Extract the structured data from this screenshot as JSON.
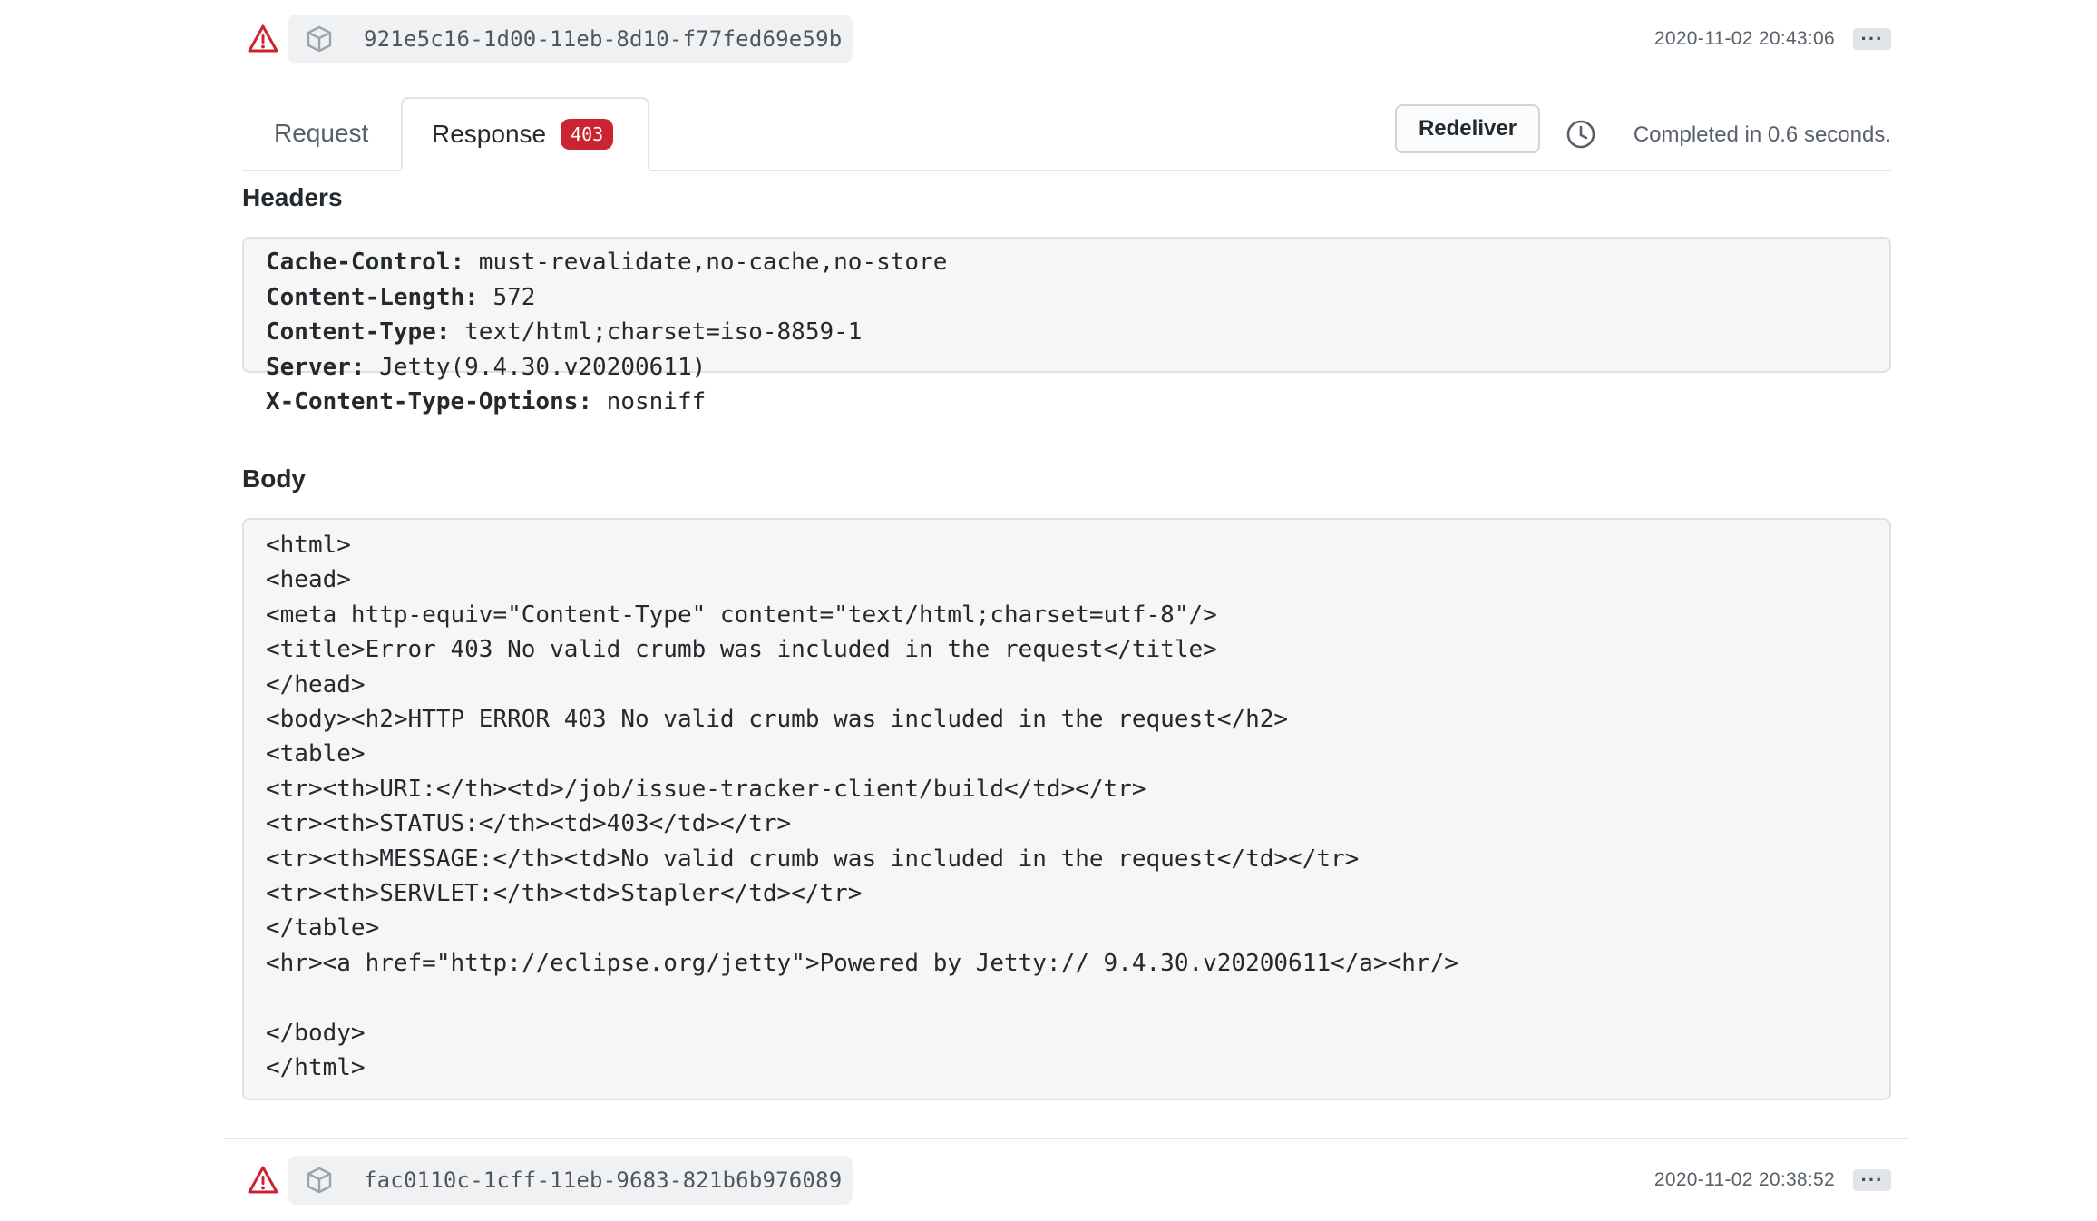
{
  "deliveries": [
    {
      "guid": "921e5c16-1d00-11eb-8d10-f77fed69e59b",
      "timestamp": "2020-11-02 20:43:06",
      "status_icon": "alert-icon",
      "more_label": "···"
    },
    {
      "guid": "fac0110c-1cff-11eb-9683-821b6b976089",
      "timestamp": "2020-11-02 20:38:52",
      "status_icon": "alert-icon",
      "more_label": "···"
    }
  ],
  "tabs": {
    "request": "Request",
    "response": "Response",
    "response_badge": "403"
  },
  "actions": {
    "redeliver": "Redeliver",
    "completed": "Completed in 0.6 seconds."
  },
  "headers_section": {
    "title": "Headers",
    "items": [
      {
        "key": "Cache-Control:",
        "value": " must-revalidate,no-cache,no-store"
      },
      {
        "key": "Content-Length:",
        "value": " 572"
      },
      {
        "key": "Content-Type:",
        "value": " text/html;charset=iso-8859-1"
      },
      {
        "key": "Server:",
        "value": " Jetty(9.4.30.v20200611)"
      },
      {
        "key": "X-Content-Type-Options:",
        "value": " nosniff"
      }
    ]
  },
  "body_section": {
    "title": "Body",
    "content": "<html>\n<head>\n<meta http-equiv=\"Content-Type\" content=\"text/html;charset=utf-8\"/>\n<title>Error 403 No valid crumb was included in the request</title>\n</head>\n<body><h2>HTTP ERROR 403 No valid crumb was included in the request</h2>\n<table>\n<tr><th>URI:</th><td>/job/issue-tracker-client/build</td></tr>\n<tr><th>STATUS:</th><td>403</td></tr>\n<tr><th>MESSAGE:</th><td>No valid crumb was included in the request</td></tr>\n<tr><th>SERVLET:</th><td>Stapler</td></tr>\n</table>\n<hr><a href=\"http://eclipse.org/jetty\">Powered by Jetty:// 9.4.30.v20200611</a><hr/>\n\n</body>\n</html>"
  },
  "colors": {
    "alert": "#cb2431",
    "badge": "#cb2431",
    "pill_bg": "#eff1f3",
    "code_bg": "#f6f6f6"
  }
}
